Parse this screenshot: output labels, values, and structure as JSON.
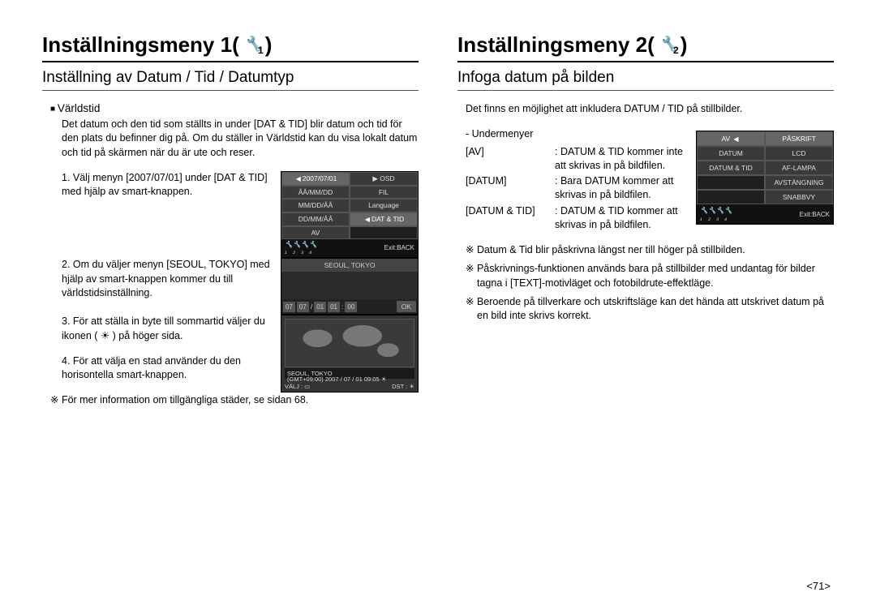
{
  "left": {
    "h1": "Inställningsmeny 1(",
    "h1_close": ")",
    "icon_sub": "1",
    "h2": "Inställning av Datum / Tid / Datumtyp",
    "sub_heading": "Världstid",
    "intro": "Det datum och den tid som ställts in under [DAT & TID] blir datum och tid för den plats du befinner dig på. Om du ställer in Världstid kan du visa lokalt datum och tid på skärmen när du är ute och reser.",
    "step1": "1. Välj menyn [2007/07/01] under [DAT & TID] med hjälp av smart-knappen.",
    "step2": "2. Om du väljer menyn [SEOUL, TOKYO] med hjälp av smart-knappen kommer du till världstidsinställning.",
    "step3": "3. För att ställa in byte till sommartid väljer du ikonen (  ☀  ) på höger sida.",
    "step4": "4. För att välja en stad använder du den horisontella smart-knappen.",
    "footnote": "För mer information om tillgängliga städer, se sidan 68.",
    "lcd1": {
      "r1a": "2007/07/01",
      "r1b": "OSD",
      "r2a": "ÅÅ/MM/DD",
      "r2b": "FIL",
      "r3a": "MM/DD/ÅÅ",
      "r3b": "Language",
      "r4a": "DD/MM/ÅÅ",
      "r4b": "DAT & TID",
      "r5a": "AV",
      "exit": "Exit:BACK"
    },
    "lcd2": {
      "title": "SEOUL, TOKYO",
      "nums": [
        "07",
        "07",
        "/",
        "01",
        "01",
        ":",
        "00"
      ],
      "ok": "OK"
    },
    "lcd3": {
      "city": "SEOUL, TOKYO",
      "gmt": "(GMT+09:00) 2007 / 07 / 01 09:05 ☀",
      "sel": "VÄLJ : ▭",
      "dst": "DST : ☀"
    }
  },
  "right": {
    "h1": "Inställningsmeny 2(",
    "h1_close": ")",
    "icon_sub": "2",
    "h2": "Infoga datum på bilden",
    "intro": "Det finns en möjlighet att inkludera DATUM / TID på stillbilder.",
    "sub_label": "- Undermenyer",
    "menu": [
      {
        "k": "[AV]",
        "v": ": DATUM & TID kommer inte att skrivas in på bildfilen."
      },
      {
        "k": "[DATUM]",
        "v": ": Bara DATUM kommer att skrivas in på bildfilen."
      },
      {
        "k": "[DATUM & TID]",
        "v": ": DATUM & TID kommer att skrivas in på bildfilen."
      }
    ],
    "notes": [
      "Datum & Tid blir påskrivna längst ner till höger på stillbilden.",
      "Påskrivnings-funktionen används bara på stillbilder med undantag för bilder tagna i [TEXT]-motivläget och fotobildrute-effektläge.",
      "Beroende på tillverkare och utskriftsläge kan det hända att utskrivet datum på en bild inte skrivs korrekt."
    ],
    "lcd": {
      "r1a": "AV",
      "r1b": "PÅSKRIFT",
      "r2a": "DATUM",
      "r2b": "LCD",
      "r3a": "DATUM & TID",
      "r3b": "AF-LAMPA",
      "r4b": "AVSTÄNGNING",
      "r5b": "SNABBVY",
      "exit": "Exit:BACK"
    }
  },
  "page": "<71>"
}
